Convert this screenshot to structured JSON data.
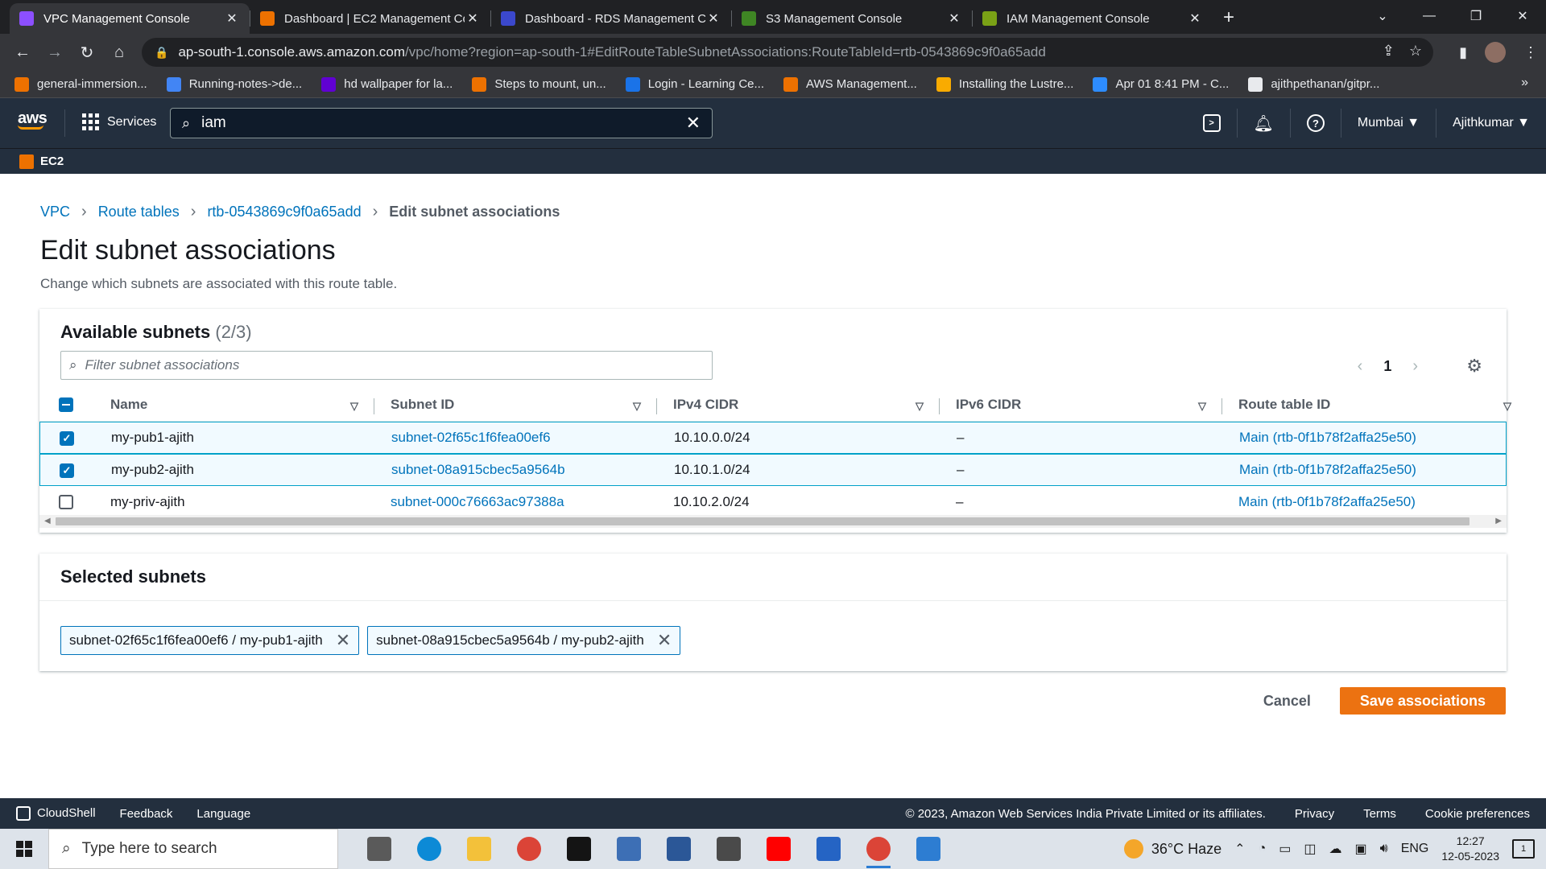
{
  "browser": {
    "tabs": [
      {
        "title": "VPC Management Console",
        "color": "#8c4fff",
        "active": true
      },
      {
        "title": "Dashboard | EC2 Management Co",
        "color": "#ed7100",
        "active": false
      },
      {
        "title": "Dashboard - RDS Management C",
        "color": "#3b48cc",
        "active": false
      },
      {
        "title": "S3 Management Console",
        "color": "#3f8624",
        "active": false
      },
      {
        "title": "IAM Management Console",
        "color": "#7aa116",
        "active": false
      }
    ],
    "url_host": "ap-south-1.console.aws.amazon.com",
    "url_path": "/vpc/home?region=ap-south-1#EditRouteTableSubnetAssociations:RouteTableId=rtb-0543869c9f0a65add",
    "bookmarks": [
      {
        "label": "general-immersion...",
        "color": "#ed7100"
      },
      {
        "label": "Running-notes->de...",
        "color": "#4285f4"
      },
      {
        "label": "hd wallpaper for la...",
        "color": "#6001d2"
      },
      {
        "label": "Steps to mount, un...",
        "color": "#ed7100"
      },
      {
        "label": "Login - Learning Ce...",
        "color": "#1a73e8"
      },
      {
        "label": "AWS Management...",
        "color": "#ed7100"
      },
      {
        "label": "Installing the Lustre...",
        "color": "#f9ab00"
      },
      {
        "label": "Apr 01 8:41 PM - C...",
        "color": "#2d8cff"
      },
      {
        "label": "ajithpethanan/gitpr...",
        "color": "#e8eaed"
      }
    ]
  },
  "aws": {
    "logo": "aws",
    "services_label": "Services",
    "search_value": "iam",
    "region": "Mumbai",
    "user": "Ajithkumar",
    "favorite": "EC2"
  },
  "page": {
    "breadcrumb": {
      "vpc": "VPC",
      "route_tables": "Route tables",
      "rtb": "rtb-0543869c9f0a65add",
      "current": "Edit subnet associations"
    },
    "title": "Edit subnet associations",
    "description": "Change which subnets are associated with this route table."
  },
  "available": {
    "heading": "Available subnets",
    "count": "(2/3)",
    "filter_placeholder": "Filter subnet associations",
    "page": "1",
    "columns": {
      "name": "Name",
      "subnet_id": "Subnet ID",
      "ipv4": "IPv4 CIDR",
      "ipv6": "IPv6 CIDR",
      "route_table": "Route table ID"
    },
    "rows": [
      {
        "name": "my-pub1-ajith",
        "subnet_id": "subnet-02f65c1f6fea00ef6",
        "ipv4": "10.10.0.0/24",
        "ipv6": "–",
        "route_table": "Main (rtb-0f1b78f2affa25e50)",
        "selected": true
      },
      {
        "name": "my-pub2-ajith",
        "subnet_id": "subnet-08a915cbec5a9564b",
        "ipv4": "10.10.1.0/24",
        "ipv6": "–",
        "route_table": "Main (rtb-0f1b78f2affa25e50)",
        "selected": true
      },
      {
        "name": "my-priv-ajith",
        "subnet_id": "subnet-000c76663ac97388a",
        "ipv4": "10.10.2.0/24",
        "ipv6": "–",
        "route_table": "Main (rtb-0f1b78f2affa25e50)",
        "selected": false
      }
    ]
  },
  "selected": {
    "heading": "Selected subnets",
    "tokens": [
      "subnet-02f65c1f6fea00ef6 / my-pub1-ajith",
      "subnet-08a915cbec5a9564b / my-pub2-ajith"
    ]
  },
  "actions": {
    "cancel": "Cancel",
    "save": "Save associations"
  },
  "footer": {
    "cloudshell": "CloudShell",
    "feedback": "Feedback",
    "language": "Language",
    "copyright": "© 2023, Amazon Web Services India Private Limited or its affiliates.",
    "privacy": "Privacy",
    "terms": "Terms",
    "cookies": "Cookie preferences"
  },
  "taskbar": {
    "search_placeholder": "Type here to search",
    "weather": "36°C  Haze",
    "lang": "ENG",
    "time": "12:27",
    "date": "12-05-2023",
    "notifications": "1",
    "apps": [
      {
        "name": "task-view",
        "color": "#5a5a5a"
      },
      {
        "name": "edge",
        "color": "#0c8ad6"
      },
      {
        "name": "file-explorer",
        "color": "#f3c13a"
      },
      {
        "name": "chrome",
        "color": "#db4437"
      },
      {
        "name": "netflix",
        "color": "#141414"
      },
      {
        "name": "network-tool",
        "color": "#3d6fb5"
      },
      {
        "name": "remote-desktop",
        "color": "#2b5797"
      },
      {
        "name": "app-utility",
        "color": "#4a4a4a"
      },
      {
        "name": "youtube",
        "color": "#ff0000"
      },
      {
        "name": "store",
        "color": "#2564c4"
      },
      {
        "name": "chrome-profile",
        "color": "#db4437"
      },
      {
        "name": "photos",
        "color": "#2d7dd2"
      }
    ]
  }
}
